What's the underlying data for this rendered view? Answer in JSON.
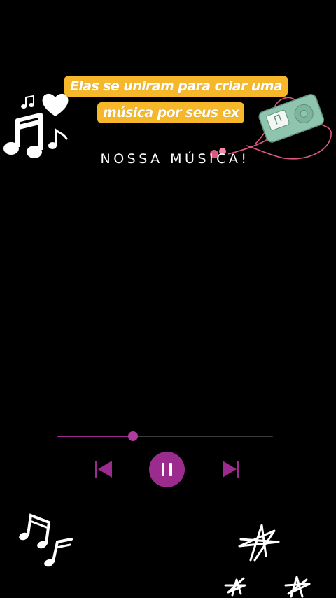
{
  "caption": {
    "line1": "Elas se uniram para criar uma",
    "line2": "música por seus ex"
  },
  "subtitle": "NOSSA MÚSICA!",
  "player": {
    "progress": 0.35,
    "state": "playing"
  },
  "colors": {
    "background": "#000000",
    "caption_bg": "#F6B82A",
    "accent": "#9B2C8E",
    "accent_light": "#B23A9F",
    "track": "#3A3A3A",
    "device": "#8FC4AF",
    "earbuds": "#E0577E"
  },
  "icons": {
    "prev": "skip-previous-icon",
    "pause": "pause-icon",
    "next": "skip-next-icon",
    "notes_left": "music-notes-icon",
    "heart": "heart-icon",
    "mp3_player": "mp3-player-icon",
    "notes_bottom": "music-notes-icon",
    "stars": "star-doodle-icon"
  }
}
